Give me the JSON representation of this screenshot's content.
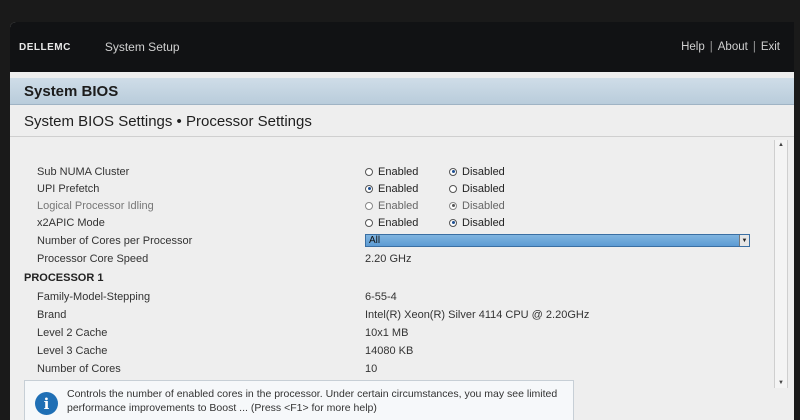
{
  "topbar": {
    "logo": "DELLEMC",
    "app_title": "System Setup",
    "links": [
      "Help",
      "About",
      "Exit"
    ],
    "separator": "|"
  },
  "bios_header": "System BIOS",
  "page_title": "System BIOS Settings • Processor Settings",
  "settings": [
    {
      "label": "Sub NUMA Cluster",
      "type": "radio",
      "options": [
        "Enabled",
        "Disabled"
      ],
      "selected": "Disabled",
      "disabled": false
    },
    {
      "label": "UPI Prefetch",
      "type": "radio",
      "options": [
        "Enabled",
        "Disabled"
      ],
      "selected": "Enabled",
      "disabled": false
    },
    {
      "label": "Logical Processor Idling",
      "type": "radio",
      "options": [
        "Enabled",
        "Disabled"
      ],
      "selected": "Disabled",
      "disabled": true
    },
    {
      "label": "x2APIC Mode",
      "type": "radio",
      "options": [
        "Enabled",
        "Disabled"
      ],
      "selected": "Disabled",
      "disabled": false
    },
    {
      "label": "Number of Cores per Processor",
      "type": "select",
      "value": "All",
      "disabled": false
    },
    {
      "label": "Processor Core Speed",
      "type": "text",
      "value": "2.20 GHz",
      "disabled": false
    }
  ],
  "processor_section": {
    "heading": "PROCESSOR 1",
    "rows": [
      {
        "label": "Family-Model-Stepping",
        "value": "6-55-4"
      },
      {
        "label": "Brand",
        "value": "Intel(R) Xeon(R) Silver 4114 CPU @ 2.20GHz"
      },
      {
        "label": "Level 2 Cache",
        "value": "10x1 MB"
      },
      {
        "label": "Level 3 Cache",
        "value": "14080 KB"
      },
      {
        "label": "Number of Cores",
        "value": "10"
      }
    ]
  },
  "info_box": {
    "text": "Controls the number of enabled cores in the processor. Under certain circumstances, you may see limited performance improvements to Boost ... (Press <F1> for more help)"
  },
  "colors": {
    "topbar_bg": "#111214",
    "header_bg": "#c5d6e4",
    "select_bg": "#6aa6da",
    "info_icon": "#1f6fb5"
  }
}
